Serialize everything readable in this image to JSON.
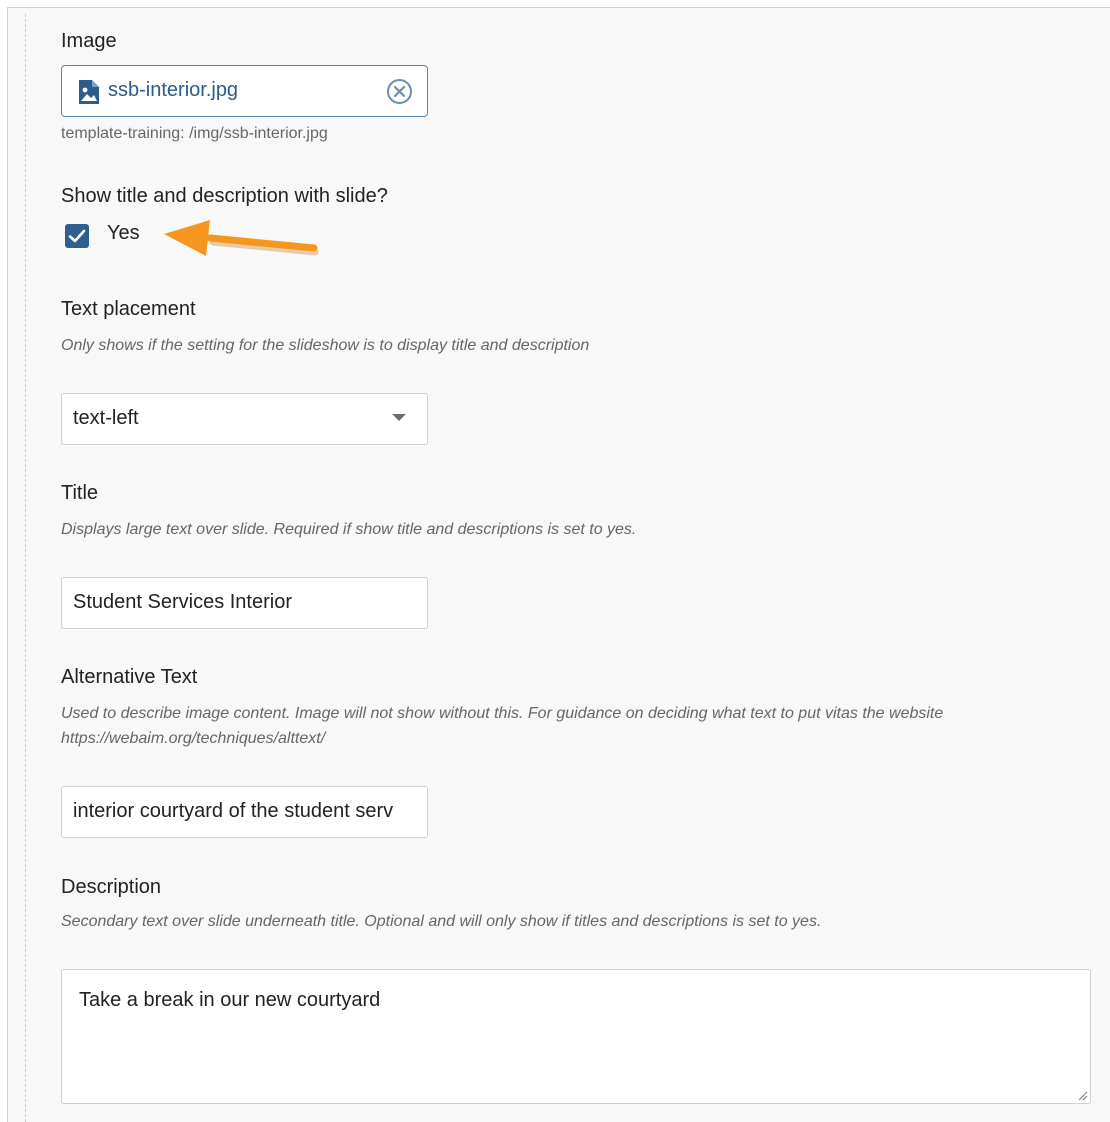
{
  "image": {
    "label": "Image",
    "filename": "ssb-interior.jpg",
    "path": "template-training: /img/ssb-interior.jpg"
  },
  "show_title": {
    "label": "Show title and description with slide?",
    "checkbox_label": "Yes",
    "checked": true
  },
  "text_placement": {
    "label": "Text placement",
    "help": "Only shows if the setting for the slideshow is to display title and description",
    "value": "text-left"
  },
  "title": {
    "label": "Title",
    "help": "Displays large text over slide. Required if show title and descriptions is set to yes.",
    "value": "Student Services Interior"
  },
  "alt_text": {
    "label": "Alternative Text",
    "help_line1": "Used to describe image content. Image will not show without this. For guidance on deciding what text to put vitas the website",
    "help_line2": "https://webaim.org/techniques/alttext/",
    "value": "interior courtyard of the student serv"
  },
  "description": {
    "label": "Description",
    "help": "Secondary text over slide underneath title. Optional and will only show if titles and descriptions is set to yes.",
    "value": "Take a break in our new courtyard"
  },
  "colors": {
    "accent": "#2f5f8e",
    "annotation_arrow": "#f5971f"
  },
  "icons": {
    "file": "image-file-icon",
    "clear": "clear-circle-x-icon",
    "check": "checkmark-icon",
    "arrow": "annotation-arrow-icon",
    "dropdown": "caret-down-icon",
    "resize": "resize-handle-icon"
  }
}
